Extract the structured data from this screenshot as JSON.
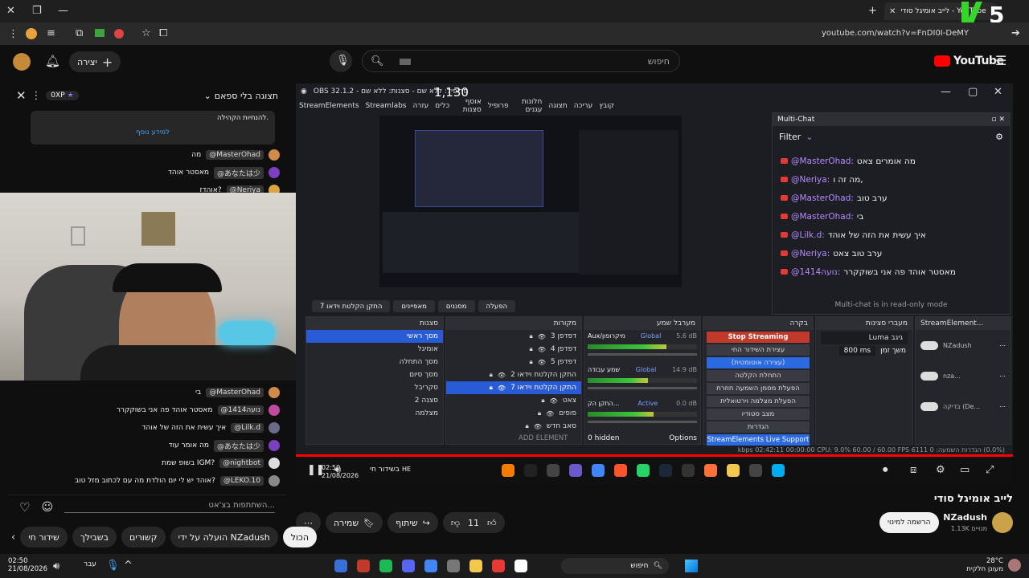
{
  "browser": {
    "tab_title": "לייב אומיגל סודי - YouTube",
    "url": "youtube.com/watch?v=FnDI0I-DeMY",
    "badge": "5",
    "colors": {
      "badge": "#37d42b"
    }
  },
  "header": {
    "search_placeholder": "חיפוש",
    "create_label": "יצירה",
    "logo_text": "YouTube"
  },
  "chat": {
    "title": "תצוגה בלי ספאם",
    "xp": "0XP",
    "pinned_text": "להנחיות הקהילה.",
    "pinned_link": "למידע נוסף",
    "top_messages": [
      {
        "user": "@MasterOhad",
        "text": "מה",
        "color": "#d08b4a"
      },
      {
        "user": "@あなたは少",
        "text": "מאסטר אוהד",
        "color": "#7b3fbf"
      },
      {
        "user": "@Neriya",
        "text": "אוהדז?",
        "color": "#d9a441"
      }
    ],
    "bottom_messages": [
      {
        "user": "@MasterOhad",
        "text": "בי",
        "color": "#d08b4a"
      },
      {
        "user": "@נועה1414",
        "text": "מאסטר אוהד פה אני בשוקקרר",
        "color": "#c04aa0"
      },
      {
        "user": "@Lilk.d",
        "text": "איך עשית את הזה של אוהד",
        "color": "#6a6a8a"
      },
      {
        "user": "@あなたは少",
        "text": "מה אומר עוד",
        "color": "#7b3fbf"
      },
      {
        "user": "@nightbot",
        "text": "בשופ שמת IGM?",
        "color": "#dddddd"
      },
      {
        "user": "@LEKO.10",
        "text": "אוהד יש לי יום הולדת מה עם לכתוב מזל טוב?",
        "color": "#888888"
      }
    ],
    "input_placeholder": "השתתפות בצ'אט..."
  },
  "obs": {
    "title": "OBS 32.1.2 - פרופיל: ללא שם - סצנות: ללא שם",
    "counter": "1,130",
    "menu": [
      "קובץ",
      "עריכה",
      "תצוגה",
      "חלונות עגנים",
      "פרופיל",
      "אוסף סצנות",
      "כלים",
      "עזרה",
      "Streamlabs",
      "StreamElements"
    ],
    "preview_tabs": [
      "הפעלה",
      "מסננים",
      "מאפיינים",
      "התקן הקלטת וידאו 7"
    ],
    "scenes_title": "סצנות",
    "scenes": [
      "מסך ראשי",
      "אומיגל",
      "מסך התחלה",
      "מסך סיום",
      "סקריבל",
      "סצנה 2",
      "מצלמה"
    ],
    "sources_title": "מקורות",
    "sources": [
      "דפדפן 3",
      "דפדפן 4",
      "דפדפן 5",
      "התקן הקלטת וידאו 2",
      "התקן הקלטת וידאו 7",
      "צאט",
      "פופים",
      "סאב חדש"
    ],
    "add_element": "ADD ELEMENT",
    "mixer_title": "מערבל שמע",
    "mixer": [
      {
        "name": "Aux/מיקרופון",
        "tag": "Global",
        "db": "5.6 dB",
        "level": 0.72
      },
      {
        "name": "שמע עבודה",
        "tag": "Global",
        "db": "14.9 dB",
        "level": 0.55
      },
      {
        "name": "התקן הק...",
        "tag": "Active",
        "db": "0.0 dB",
        "level": 0.6
      }
    ],
    "mixer_hidden": "0 hidden",
    "mixer_options": "Options",
    "controls_title": "בקרה",
    "controls": [
      "Stop Streaming",
      "עצירת השידור החי",
      "(עצירה אוטומטית)",
      "התחלת הקלטה",
      "הפעלת מסמן השמעה חוזרת",
      "הפעלת מצלמה וירטואלית",
      "מצב סטודיו",
      "הגדרות"
    ],
    "se_support": "StreamElements Live Support",
    "transitions_title": "מעברי סצינות",
    "transition": "Luma גיגב",
    "duration_label": "משך זמן",
    "duration": "800 ms",
    "se_title": "StreamElement...",
    "se_rows": [
      "NZadush",
      "nza...",
      "בדיקה (De..."
    ],
    "multichat_title": "Multi-Chat",
    "filter": "Filter",
    "multichat": [
      {
        "user": "@MasterOhad:",
        "text": "מה אומרים צאט"
      },
      {
        "user": "@Neriya:",
        "text": "מה זה ו,"
      },
      {
        "user": "@MasterOhad:",
        "text": "ערב טוב"
      },
      {
        "user": "@MasterOhad:",
        "text": "בי"
      },
      {
        "user": "@Lilk.d:",
        "text": "איך עשית את הזה של אוהד"
      },
      {
        "user": "@Neriya:",
        "text": "ערב טוב צאט"
      },
      {
        "user": "@נועה1414:",
        "text": "מאסטר אוהד פה אני בשוקקרר"
      }
    ],
    "readonly": "Multi-chat is in read-only mode",
    "status": "(0.0%) הגדרות השמעה: 0  6111 kbps  02:42:11  00:00:00  CPU: 9.0%  60.00 / 60.00 FPS"
  },
  "video": {
    "time": "02:50",
    "date": "21/08/2026",
    "lang": "HE",
    "lang_name": "עב",
    "live_label": "בשידור חי"
  },
  "info": {
    "title": "לייב אומיגל סודי",
    "channel": "NZadush",
    "subs": "1.13K מנויים",
    "subscribe": "הרשמה למינוי",
    "likes": "11",
    "share": "שיתוף",
    "save": "שמירה"
  },
  "chips": [
    "הכול",
    "הועלה על ידי NZadush",
    "קשורים",
    "בשבילך",
    "שידור חי"
  ],
  "taskbar": {
    "time": "02:50",
    "date": "21/08/2026",
    "lang": "עבר",
    "search": "חיפוש",
    "weather_temp": "28°C",
    "weather_desc": "מעונן חלקית"
  }
}
